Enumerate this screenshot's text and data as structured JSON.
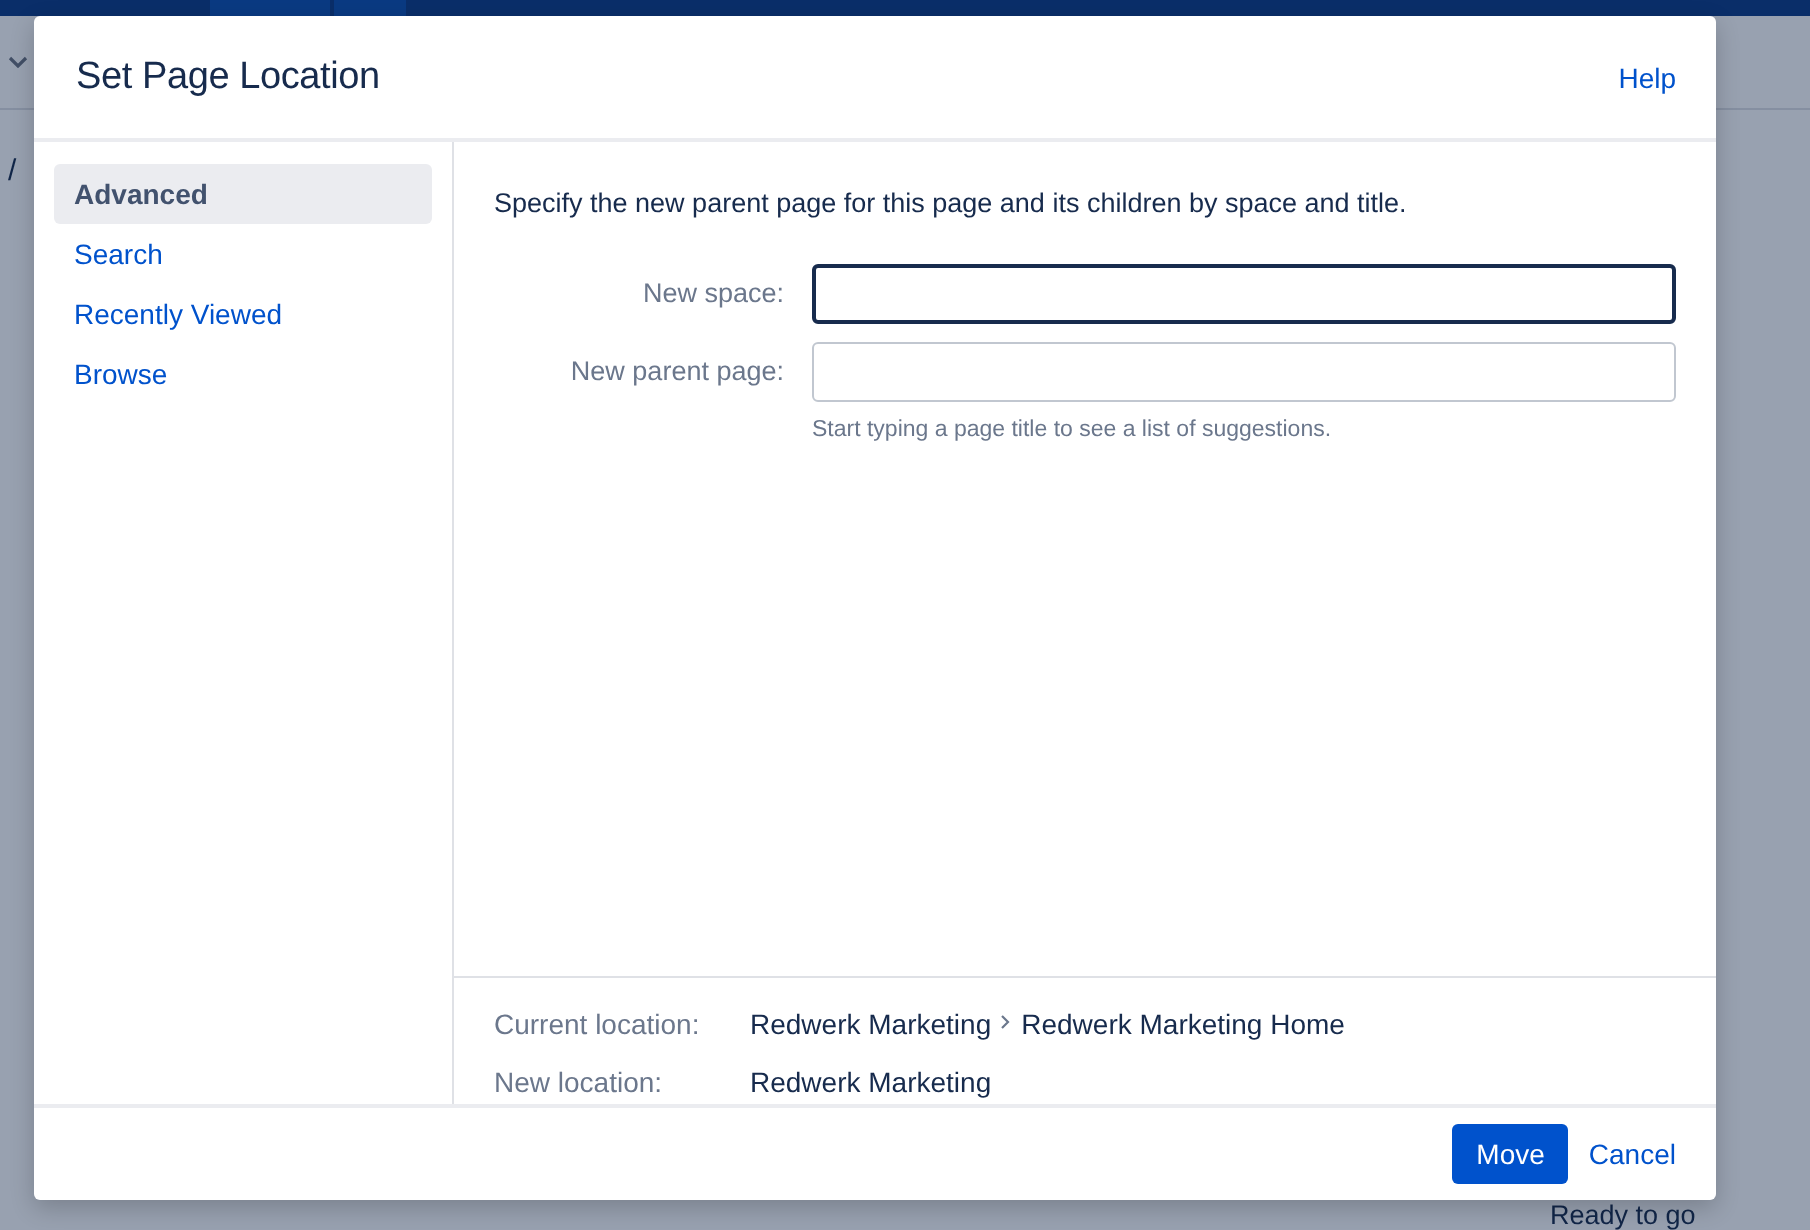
{
  "background": {
    "breadcrumb_separator": "/",
    "status": "Ready to go"
  },
  "dialog": {
    "title": "Set Page Location",
    "help": "Help",
    "nav": [
      {
        "label": "Advanced",
        "selected": true
      },
      {
        "label": "Search",
        "selected": false
      },
      {
        "label": "Recently Viewed",
        "selected": false
      },
      {
        "label": "Browse",
        "selected": false
      }
    ],
    "instructions": "Specify the new parent page for this page and its children by space and title.",
    "fields": [
      {
        "label": "New space:",
        "focused": true
      },
      {
        "label": "New parent page:",
        "focused": false,
        "hint": "Start typing a page title to see a list of suggestions."
      }
    ],
    "locations": [
      {
        "label": "Current location:",
        "path": [
          "Redwerk Marketing",
          "Redwerk Marketing Home"
        ]
      },
      {
        "label": "New location:",
        "path": [
          "Redwerk Marketing"
        ]
      }
    ],
    "buttons": [
      {
        "label": "Move",
        "kind": "primary"
      },
      {
        "label": "Cancel",
        "kind": "link"
      }
    ]
  }
}
